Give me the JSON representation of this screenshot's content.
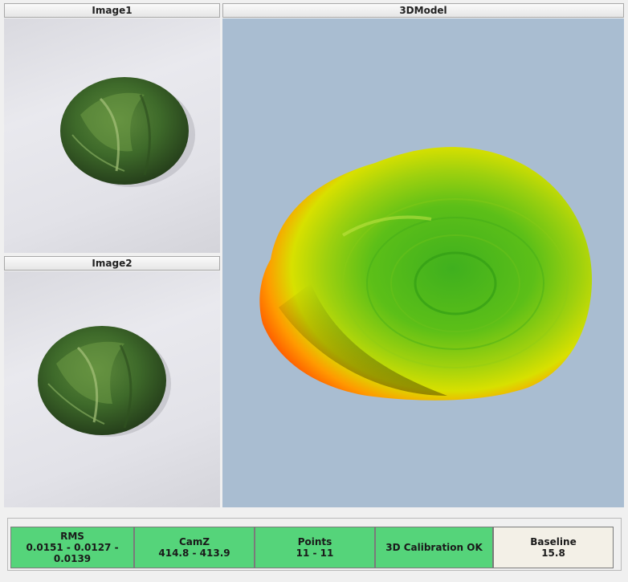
{
  "panels": {
    "image1_title": "Image1",
    "image2_title": "Image2",
    "model_title": "3DModel"
  },
  "status": [
    {
      "label": "RMS",
      "value": "0.0151 - 0.0127 - 0.0139",
      "state": "ok"
    },
    {
      "label": "CamZ",
      "value": "414.8 - 413.9",
      "state": "ok"
    },
    {
      "label": "Points",
      "value": "11 - 11",
      "state": "ok"
    },
    {
      "label": "",
      "value": "3D Calibration OK",
      "state": "ok"
    },
    {
      "label": "Baseline",
      "value": "15.8",
      "state": "neutral"
    }
  ],
  "colors": {
    "ok": "#55d47a",
    "neutral": "#f3f0e7",
    "model_bg": "#a9bdd1"
  },
  "icons": {
    "image1": "brussels-sprout-photo",
    "image2": "brussels-sprout-photo",
    "model": "3d-height-map-mesh"
  }
}
